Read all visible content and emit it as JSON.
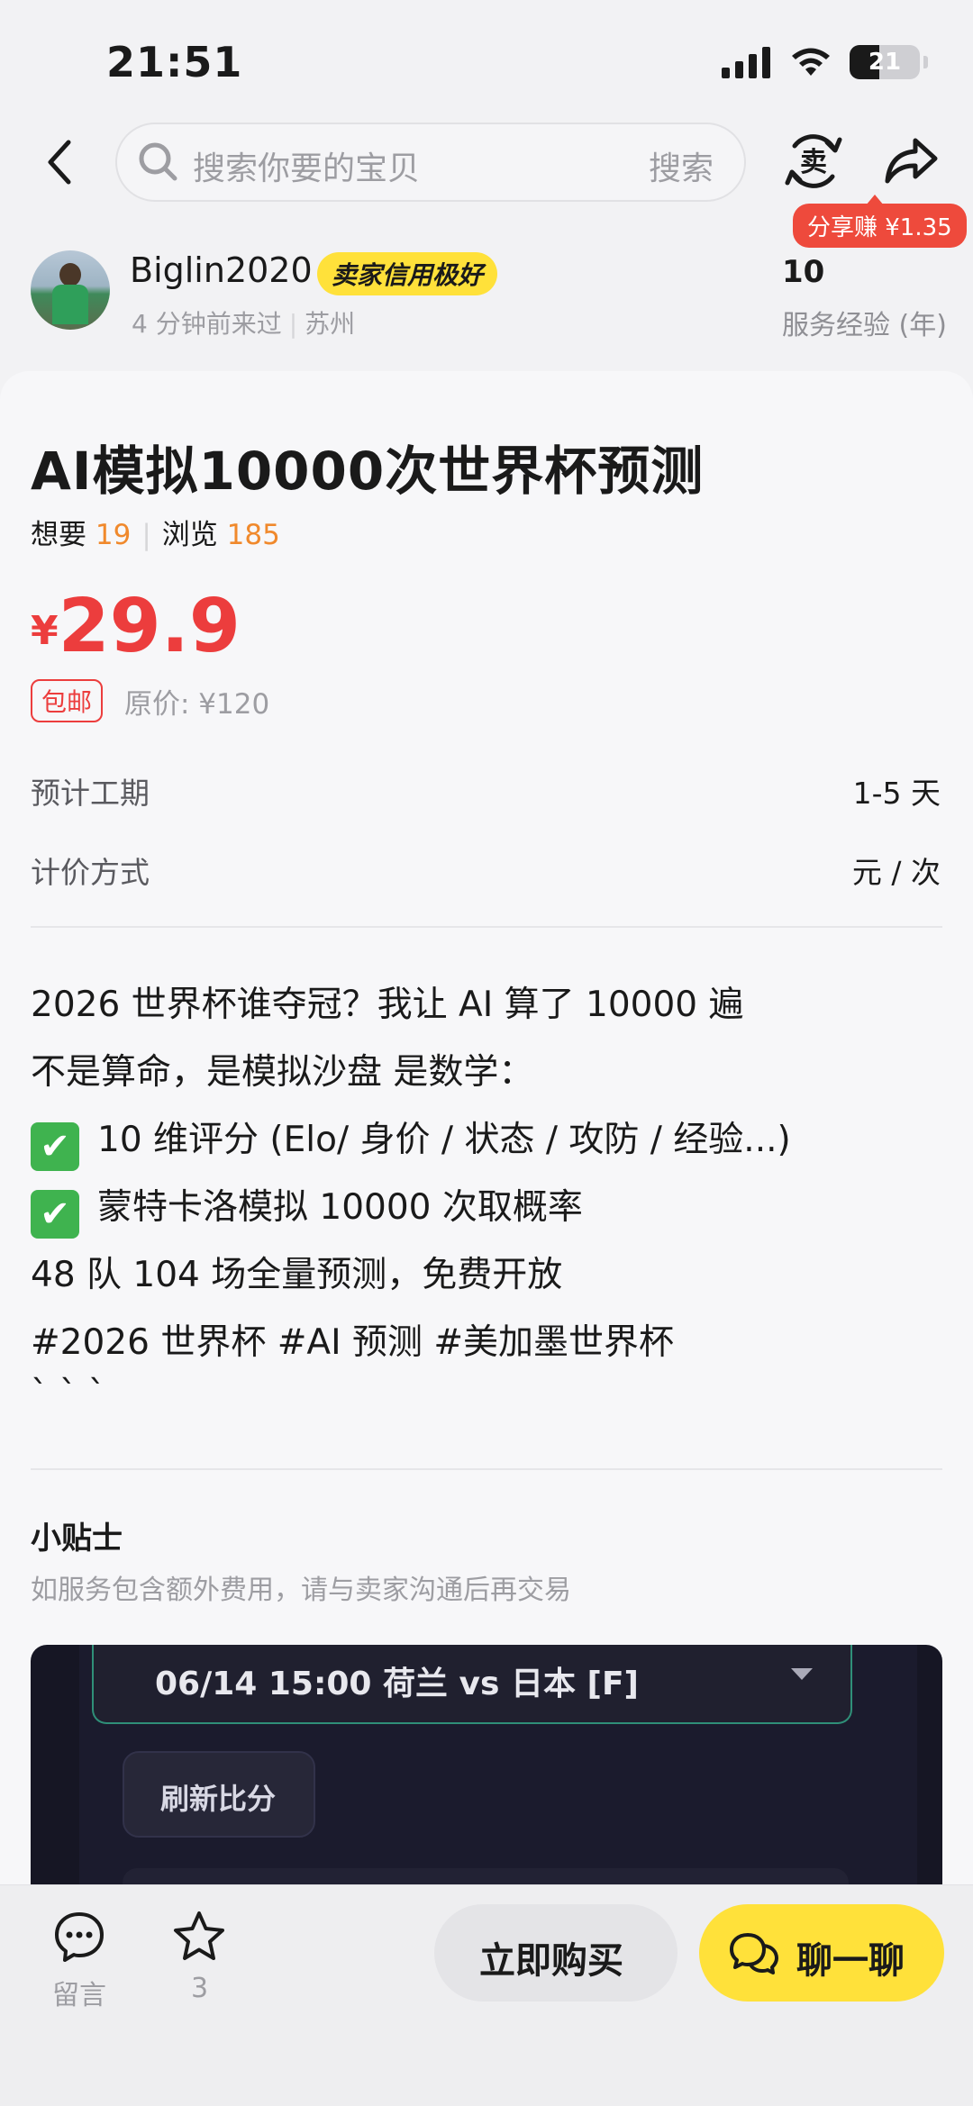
{
  "status_bar": {
    "time": "21:51",
    "battery": "21"
  },
  "search": {
    "placeholder": "搜索你要的宝贝",
    "button": "搜索"
  },
  "header": {
    "sell_icon": "sell-icon",
    "share_badge": "分享赚 ¥1.35"
  },
  "seller": {
    "name": "Biglin2020",
    "credit_badge": "卖家信用极好",
    "last_seen": "4 分钟前来过",
    "location": "苏州",
    "experience_value": "10",
    "experience_label": "服务经验 (年)"
  },
  "item": {
    "title": "AI模拟10000次世界杯预测",
    "want_label": "想要",
    "want_count": "19",
    "view_label": "浏览",
    "view_count": "185",
    "price_currency": "¥",
    "price": "29.9",
    "free_shipping": "包邮",
    "original_price": "原价: ¥120",
    "attributes": [
      {
        "label": "预计工期",
        "value": "1-5 天"
      },
      {
        "label": "计价方式",
        "value": "元 / 次"
      }
    ],
    "description": {
      "line1": "2026 世界杯谁夺冠？我让 AI 算了 10000 遍",
      "line2": "不是算命，是模拟沙盘 是数学：",
      "line3": "10 维评分 (Elo/ 身价 / 状态 / 攻防 / 经验...)",
      "line4": "蒙特卡洛模拟 10000 次取概率",
      "line5": "48 队 104 场全量预测，免费开放",
      "line6": "#2026 世界杯 #AI 预测 #美加墨世界杯",
      "line7": "` ` `"
    },
    "check_glyph": "✔"
  },
  "tips": {
    "title": "小贴士",
    "text": "如服务包含额外费用，请与卖家沟通后再交易"
  },
  "preview_image": {
    "match": "06/14 15:00 荷兰 vs 日本 [F]",
    "refresh_button": "刷新比分"
  },
  "bottom_bar": {
    "comment_label": "留言",
    "favorite_count": "3",
    "buy_button": "立即购买",
    "chat_button": "聊一聊"
  },
  "colors": {
    "price_red": "#ec3d3d",
    "accent_yellow": "#ffe13a",
    "count_orange": "#f0892c",
    "check_green": "#3fb34f"
  }
}
